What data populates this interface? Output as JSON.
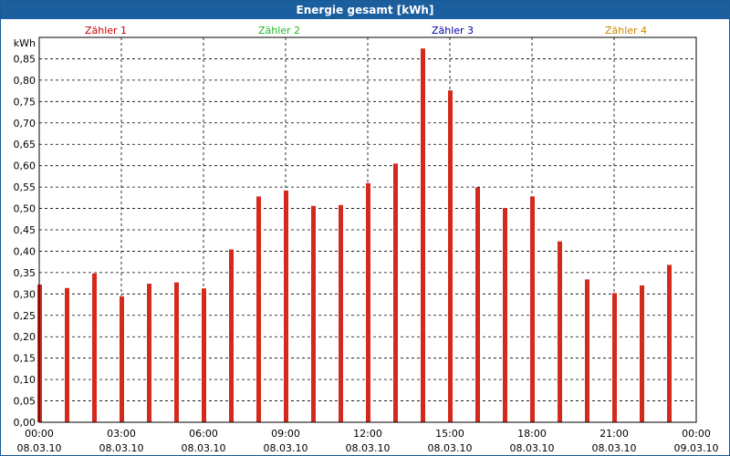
{
  "window": {
    "title": "Energie gesamt [kWh]"
  },
  "chart_data": {
    "type": "bar",
    "title": "Energie gesamt [kWh]",
    "ylabel": "kWh",
    "ylim": [
      0,
      0.9
    ],
    "yticks": [
      "0,00",
      "0,05",
      "0,10",
      "0,15",
      "0,20",
      "0,25",
      "0,30",
      "0,35",
      "0,40",
      "0,45",
      "0,50",
      "0,55",
      "0,60",
      "0,65",
      "0,70",
      "0,75",
      "0,80",
      "0,85"
    ],
    "xticks": [
      {
        "time": "00:00",
        "date": "08.03.10"
      },
      {
        "time": "03:00",
        "date": "08.03.10"
      },
      {
        "time": "06:00",
        "date": "08.03.10"
      },
      {
        "time": "09:00",
        "date": "08.03.10"
      },
      {
        "time": "12:00",
        "date": "08.03.10"
      },
      {
        "time": "15:00",
        "date": "08.03.10"
      },
      {
        "time": "18:00",
        "date": "08.03.10"
      },
      {
        "time": "21:00",
        "date": "08.03.10"
      },
      {
        "time": "00:00",
        "date": "09.03.10"
      }
    ],
    "legend": [
      {
        "label": "Zähler 1",
        "color": "#cc0000"
      },
      {
        "label": "Zähler 2",
        "color": "#22bb22"
      },
      {
        "label": "Zähler 3",
        "color": "#0000aa"
      },
      {
        "label": "Zähler 4",
        "color": "#cc8800"
      }
    ],
    "bar_color": "#d42a1e",
    "grid": true,
    "x_hours": [
      0,
      1,
      2,
      3,
      4,
      5,
      6,
      7,
      8,
      9,
      10,
      11,
      12,
      13,
      14,
      15,
      16,
      17,
      18,
      19,
      20,
      21,
      22,
      23
    ],
    "values": [
      0.322,
      0.314,
      0.348,
      0.294,
      0.324,
      0.327,
      0.313,
      0.404,
      0.528,
      0.542,
      0.506,
      0.508,
      0.559,
      0.605,
      0.874,
      0.776,
      0.549,
      0.501,
      0.528,
      0.423,
      0.334,
      0.302,
      0.32,
      0.368
    ]
  }
}
